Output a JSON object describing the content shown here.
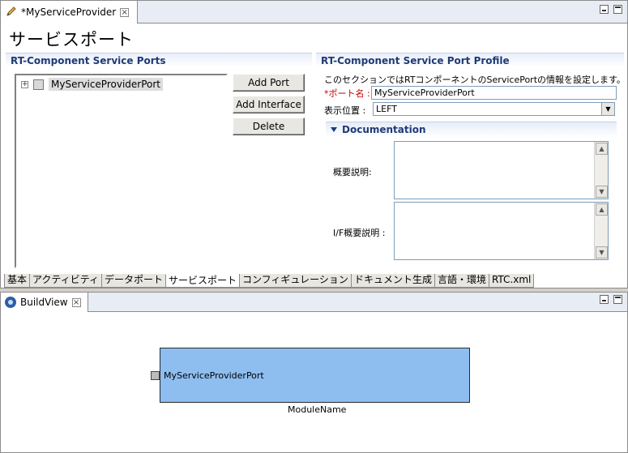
{
  "editor": {
    "tab_title": "*MyServiceProvider",
    "page_title": "サービスポート",
    "left_section": {
      "title": "RT-Component Service Ports",
      "tree": [
        {
          "label": "MyServiceProviderPort",
          "expand": "+"
        }
      ],
      "buttons": {
        "add_port": "Add Port",
        "add_interface": "Add Interface",
        "delete": "Delete"
      }
    },
    "right_section": {
      "title": "RT-Component Service Port Profile",
      "info": "このセクションではRTコンポーネントのServicePortの情報を設定します。",
      "port_name": {
        "required_mark": "*",
        "label": "ポート名 :",
        "value": "MyServiceProviderPort"
      },
      "position": {
        "label": "表示位置 :",
        "value": "LEFT"
      },
      "documentation": {
        "title": "Documentation",
        "summary_label": "概要説明:",
        "if_summary_label": "I/F概要説明 :"
      }
    },
    "bottom_tabs": [
      "基本",
      "アクティビティ",
      "データポート",
      "サービスポート",
      "コンフィギュレーション",
      "ドキュメント生成",
      "言語・環境",
      "RTC.xml"
    ],
    "active_tab": 3
  },
  "buildview": {
    "tab_title": "BuildView",
    "module_name": "ModuleName",
    "port_label": "MyServiceProviderPort"
  },
  "colors": {
    "section_title": "#1f3a75",
    "required": "#c00000",
    "module_fill": "#8ebdf0"
  },
  "icons": {
    "editor_tab": "pencil-icon",
    "close": "close-icon",
    "buildview_tab": "buildview-icon",
    "dropdown": "chevron-down-icon"
  }
}
